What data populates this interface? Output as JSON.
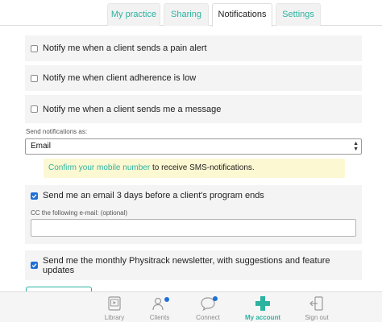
{
  "tabs": [
    {
      "label": "My practice",
      "active": false
    },
    {
      "label": "Sharing",
      "active": false
    },
    {
      "label": "Notifications",
      "active": true
    },
    {
      "label": "Settings",
      "active": false
    }
  ],
  "notifications": {
    "pain_alert": {
      "label": "Notify me when a client sends a pain alert",
      "checked": false
    },
    "adherence_low": {
      "label": "Notify me when client adherence is low",
      "checked": false
    },
    "message": {
      "label": "Notify me when a client sends me a message",
      "checked": false
    }
  },
  "send_as": {
    "label": "Send notifications as:",
    "selected": "Email"
  },
  "sms_notice": {
    "link_text": "Confirm your mobile number",
    "rest_text": " to receive SMS-notifications."
  },
  "email_before_end": {
    "label": "Send me an email 3 days before a client's program ends",
    "checked": true,
    "cc_label": "CC the following e-mail: (optional)",
    "cc_value": ""
  },
  "newsletter": {
    "label": "Send me the monthly Physitrack newsletter, with suggestions and feature updates",
    "checked": true
  },
  "bottom_nav": {
    "library": "Library",
    "clients": "Clients",
    "connect": "Connect",
    "account": "My account",
    "signout": "Sign out"
  },
  "colors": {
    "accent": "#2bb3a0",
    "checkbox": "#1f6fd6",
    "notice_bg": "#fcf8d2"
  }
}
